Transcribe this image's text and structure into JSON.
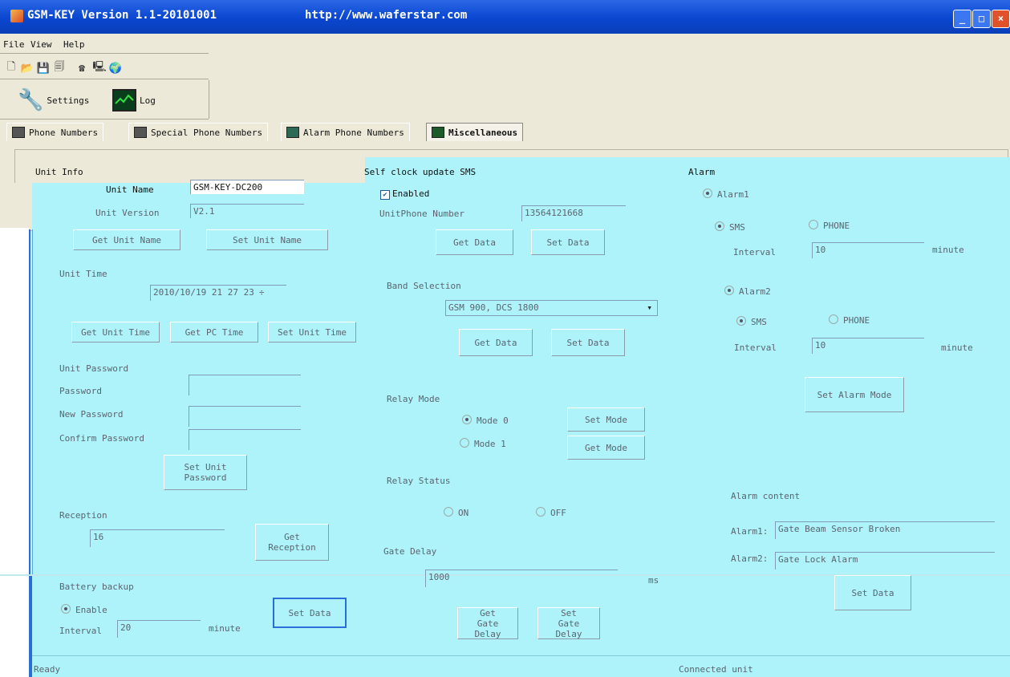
{
  "window": {
    "title": "GSM-KEY Version 1.1-20101001",
    "url": "http://www.waferstar.com"
  },
  "menu": [
    "File",
    "View",
    "Help"
  ],
  "bigbuttons": {
    "settings": "Settings",
    "log": "Log"
  },
  "tabs": [
    "Phone Numbers",
    "Special Phone Numbers",
    "Alarm Phone Numbers",
    "Miscellaneous"
  ],
  "unit_info": {
    "group": "Unit Info",
    "name_label": "Unit Name",
    "name_value": "GSM-KEY-DC200",
    "version_label": "Unit Version",
    "version_value": "V2.1",
    "get_name": "Get Unit Name",
    "set_name": "Set Unit Name",
    "time_label": "Unit Time",
    "time_value": "2010/10/19 21 27 23",
    "get_time": "Get Unit Time",
    "get_pc_time": "Get PC Time",
    "set_time": "Set Unit Time",
    "pwd_group": "Unit Password",
    "pwd_label": "Password",
    "new_pwd_label": "New Password",
    "confirm_pwd_label": "Confirm Password",
    "set_pwd": "Set Unit Password",
    "reception_label": "Reception",
    "reception_value": "16",
    "get_reception": "Get Reception",
    "battery_label": "Battery backup",
    "battery_enable": "Enable",
    "interval_label": "Interval",
    "interval_value": "20",
    "minute": "minute",
    "set_data": "Set Data"
  },
  "self_clock": {
    "group": "Self clock update SMS",
    "enabled_label": "Enabled",
    "phone_label": "UnitPhone Number",
    "phone_value": "13564121668",
    "get_data": "Get Data",
    "set_data": "Set Data",
    "band_label": "Band Selection",
    "band_value": "GSM 900, DCS 1800",
    "band_get": "Get Data",
    "band_set": "Set Data",
    "relay_mode_label": "Relay Mode",
    "mode0": "Mode 0",
    "mode1": "Mode 1",
    "set_mode": "Set Mode",
    "get_mode": "Get Mode",
    "relay_status_label": "Relay Status",
    "on": "ON",
    "off": "OFF",
    "gate_delay_label": "Gate Delay",
    "gate_delay_value": "1000",
    "ms": "ms",
    "get_gate": "Get Gate Delay",
    "set_gate": "Set Gate Delay"
  },
  "alarm": {
    "group": "Alarm",
    "alarm1": "Alarm1",
    "alarm2": "Alarm2",
    "sms": "SMS",
    "phone": "PHONE",
    "interval_label": "Interval",
    "interval1_value": "10",
    "interval2_value": "10",
    "minute": "minute",
    "set_alarm_mode": "Set Alarm Mode",
    "content_label": "Alarm content",
    "alarm1_label": "Alarm1:",
    "alarm1_value": "Gate Beam Sensor Broken",
    "alarm2_label": "Alarm2:",
    "alarm2_value": "Gate Lock Alarm",
    "set_data": "Set Data"
  },
  "status": {
    "left": "Ready",
    "right": "Connected unit"
  }
}
